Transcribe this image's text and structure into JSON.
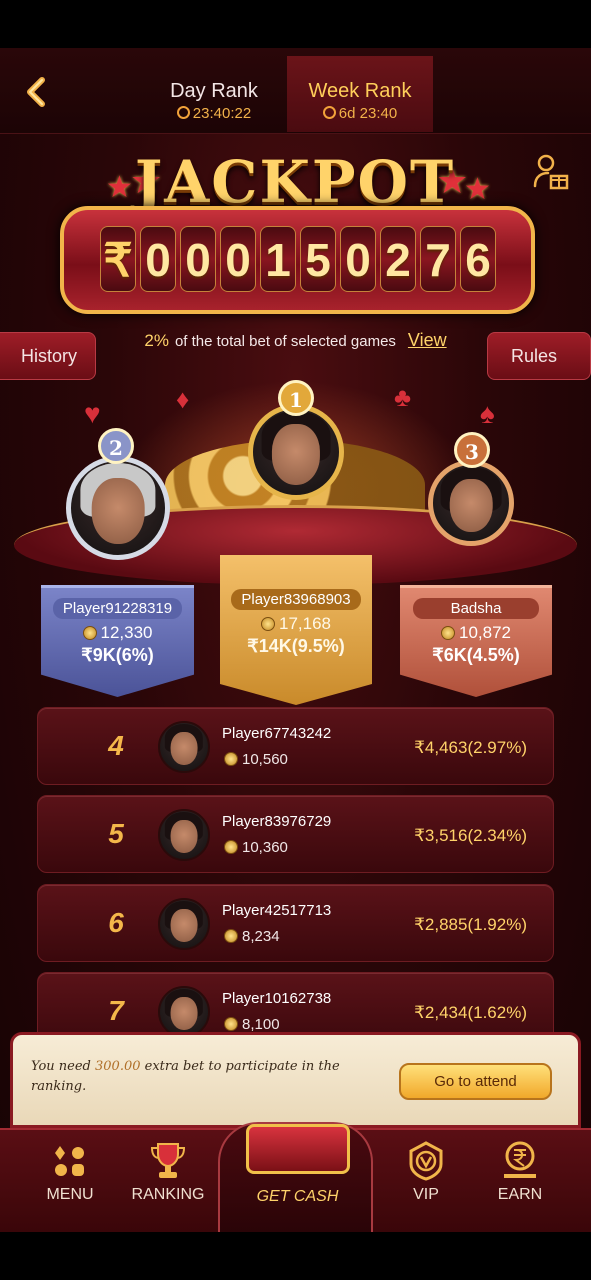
{
  "header": {
    "back_icon": "chevron-left-icon",
    "tabs": [
      {
        "label": "Day Rank",
        "timer": "23:40:22",
        "active": false
      },
      {
        "label": "Week Rank",
        "timer": "6d 23:40",
        "active": true
      }
    ]
  },
  "jackpot": {
    "title": "JACKPOT",
    "currency": "₹",
    "digits": [
      "0",
      "0",
      "0",
      "1",
      "5",
      "0",
      "2",
      "7",
      "6"
    ],
    "description_pct": "2%",
    "description": "of the total bet of selected games",
    "view_label": "View",
    "history_label": "History",
    "rules_label": "Rules",
    "gift_icon": "user-gift-icon"
  },
  "podium": [
    {
      "rank": "2",
      "name": "Player91228319",
      "coins": "12,330",
      "prize": "₹9K(6%)"
    },
    {
      "rank": "1",
      "name": "Player83968903",
      "coins": "17,168",
      "prize": "₹14K(9.5%)"
    },
    {
      "rank": "3",
      "name": "Badsha",
      "coins": "10,872",
      "prize": "₹6K(4.5%)"
    }
  ],
  "rankings": [
    {
      "rank": "4",
      "name": "Player67743242",
      "coins": "10,560",
      "prize": "₹4,463(2.97%)"
    },
    {
      "rank": "5",
      "name": "Player83976729",
      "coins": "10,360",
      "prize": "₹3,516(2.34%)"
    },
    {
      "rank": "6",
      "name": "Player42517713",
      "coins": "8,234",
      "prize": "₹2,885(1.92%)"
    },
    {
      "rank": "7",
      "name": "Player10162738",
      "coins": "8,100",
      "prize": "₹2,434(1.62%)"
    }
  ],
  "attend": {
    "text_before": "You need ",
    "amount": "300.00",
    "text_after": " extra bet to participate in the ranking.",
    "button_label": "Go to attend"
  },
  "nav": {
    "menu": "MENU",
    "ranking": "RANKING",
    "get_cash": "GET CASH",
    "vip": "VIP",
    "earn": "EARN"
  },
  "colors": {
    "accent_gold": "#ffd36a",
    "background": "#2a0608",
    "active_tab": "#6b1419"
  }
}
